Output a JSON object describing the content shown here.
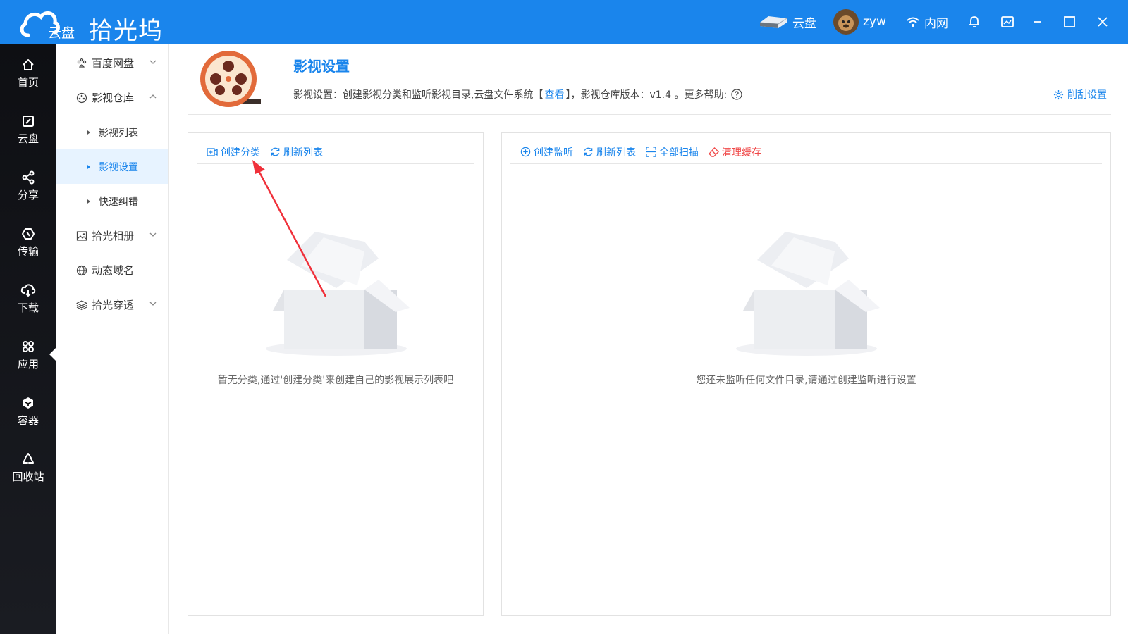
{
  "titlebar": {
    "logo_sub": "云盘",
    "app_name": "拾光坞",
    "disk_label": "云盘",
    "user_name": "zyw",
    "network_label": "内网"
  },
  "leftnav": {
    "items": [
      {
        "label": "首页",
        "icon": "home-icon"
      },
      {
        "label": "云盘",
        "icon": "cloud-disk-icon"
      },
      {
        "label": "分享",
        "icon": "share-icon"
      },
      {
        "label": "传输",
        "icon": "transfer-icon"
      },
      {
        "label": "下载",
        "icon": "download-icon"
      },
      {
        "label": "应用",
        "icon": "apps-icon"
      },
      {
        "label": "容器",
        "icon": "container-icon"
      },
      {
        "label": "回收站",
        "icon": "recycle-icon"
      }
    ],
    "active": "应用"
  },
  "submenu": {
    "baidu": "百度网盘",
    "media_warehouse": "影视仓库",
    "media_list": "影视列表",
    "media_settings": "影视设置",
    "quick_fix": "快速纠错",
    "album": "拾光相册",
    "ddns": "动态域名",
    "tunnel": "拾光穿透"
  },
  "page": {
    "title": "影视设置",
    "desc_prefix": "影视设置：创建影视分类和监听影视目录,云盘文件系统【",
    "desc_link": "查看",
    "desc_suffix": "】，影视仓库版本：v1.4 。更多帮助:",
    "scrape_settings": "削刮设置"
  },
  "left_panel": {
    "create_category": "创建分类",
    "refresh_list": "刷新列表",
    "empty_text": "暂无分类,通过'创建分类'来创建自己的影视展示列表吧"
  },
  "right_panel": {
    "create_watch": "创建监听",
    "refresh_list": "刷新列表",
    "scan_all": "全部扫描",
    "clear_cache": "清理缓存",
    "empty_text": "您还未监听任何文件目录,请通过创建监听进行设置"
  },
  "colors": {
    "accent": "#1a85ec",
    "danger": "#f04848",
    "nav_bg": "#0e0f13"
  }
}
